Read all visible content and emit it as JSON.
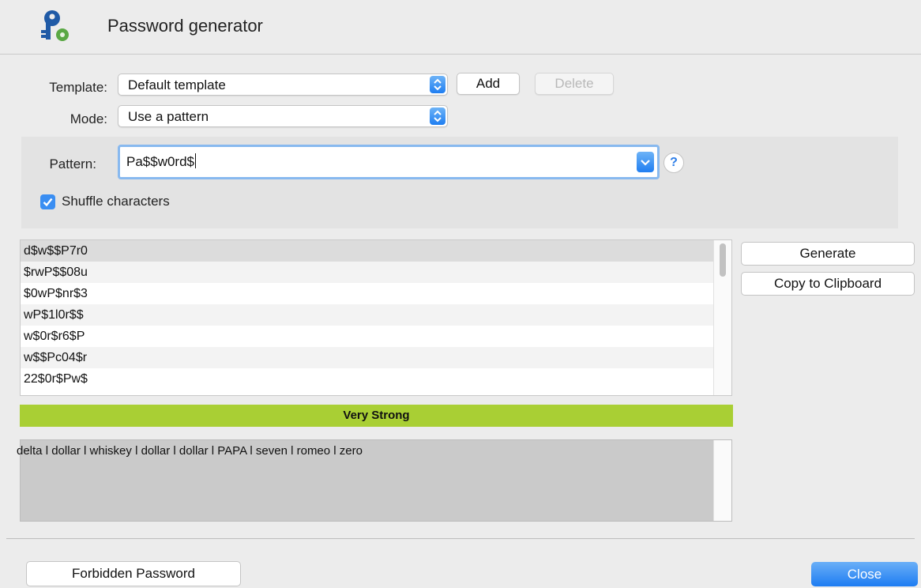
{
  "window": {
    "title": "Password generator"
  },
  "icons": {
    "app": "key-gear-icon",
    "select_arrows": "up-down-chevron-icon",
    "dropdown": "chevron-down-icon",
    "help": "question-icon",
    "check": "checkmark-icon"
  },
  "colors": {
    "accent": "#2f86f3",
    "strength_bar": "#a9cf34"
  },
  "form": {
    "template_label": "Template:",
    "template_value": "Default template",
    "add_label": "Add",
    "delete_label": "Delete",
    "mode_label": "Mode:",
    "mode_value": "Use a pattern",
    "pattern_label": "Pattern:",
    "pattern_value": "Pa$$w0rd$",
    "help_label": "?",
    "shuffle_label": "Shuffle characters",
    "shuffle_checked": true
  },
  "passwords": [
    "d$w$$P7r0",
    "$rwP$$08u",
    "$0wP$nr$3",
    "wP$1l0r$$",
    "w$0r$r6$P",
    "w$$Pc04$r",
    "22$0r$Pw$"
  ],
  "actions": {
    "generate": "Generate",
    "copy": "Copy to Clipboard"
  },
  "strength": {
    "label": "Very Strong"
  },
  "phonetic": {
    "text": "delta l dollar l whiskey l dollar l dollar l PAPA l seven l romeo l zero"
  },
  "footer": {
    "forbidden": "Forbidden Password",
    "close": "Close"
  }
}
